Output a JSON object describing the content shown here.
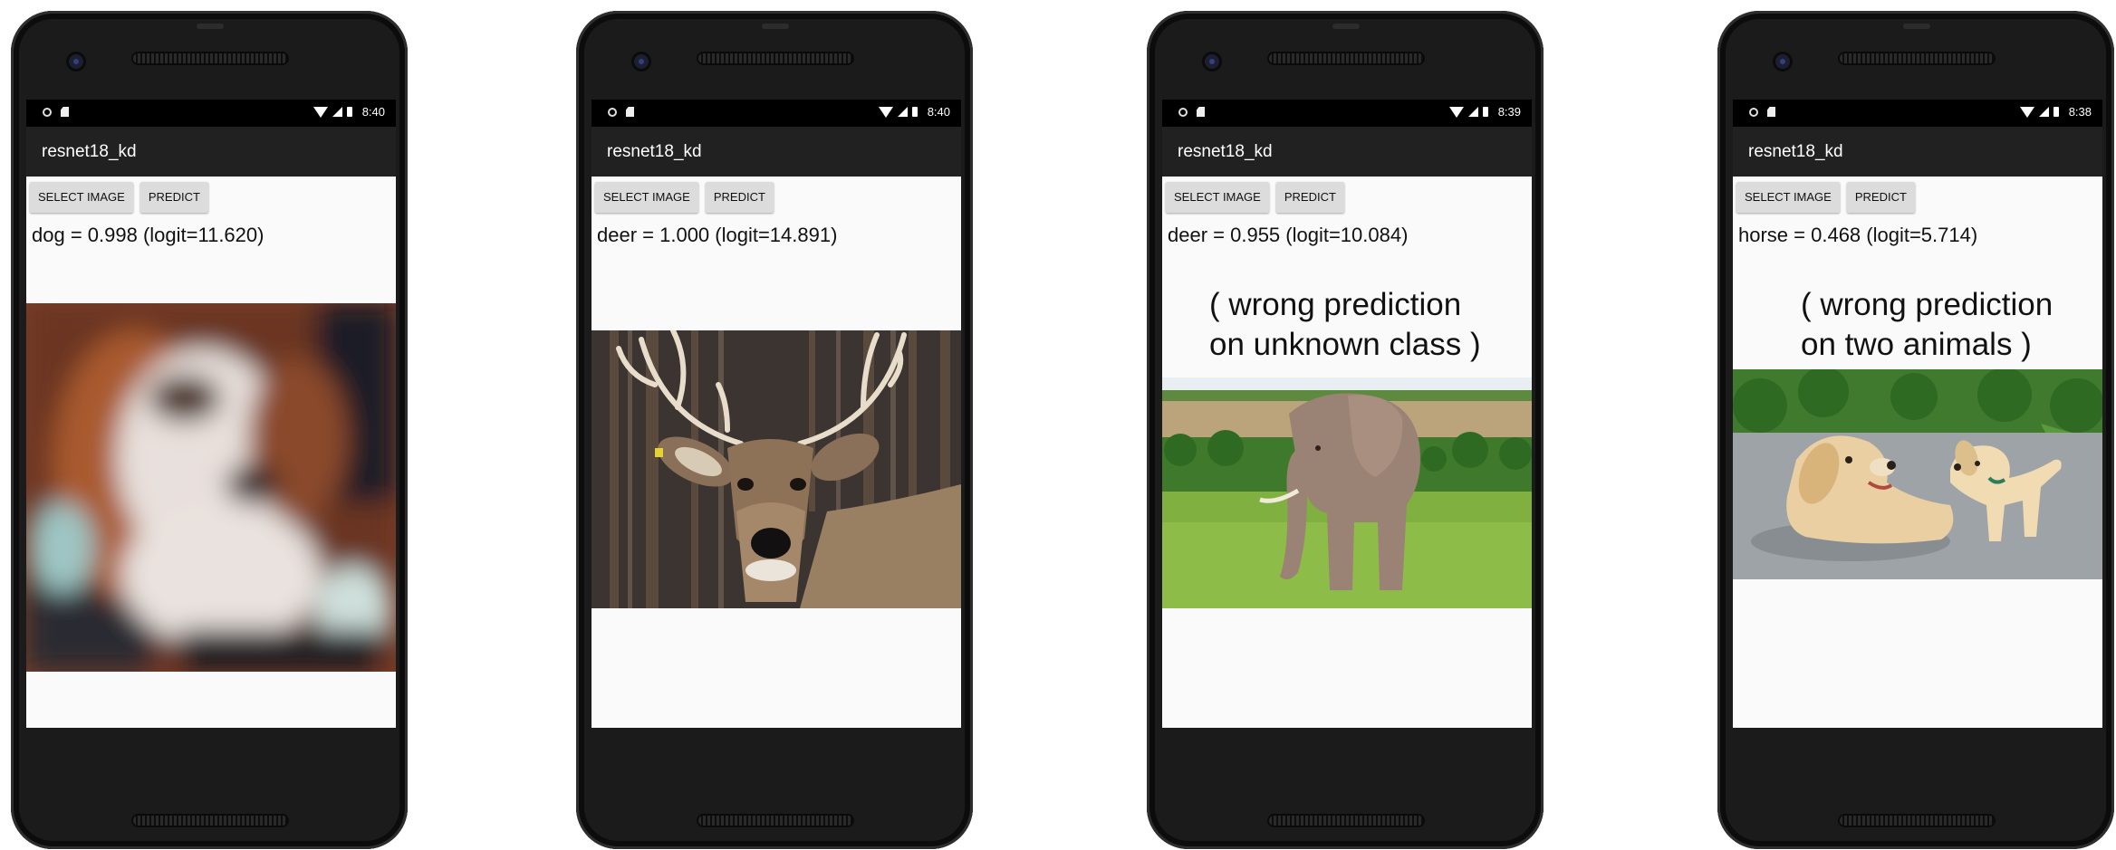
{
  "phones": [
    {
      "status": {
        "time": "8:40"
      },
      "app_title": "resnet18_kd",
      "buttons": {
        "select": "SELECT IMAGE",
        "predict": "PREDICT"
      },
      "result": "dog = 0.998 (logit=11.620)",
      "image": "dog-image",
      "annotation": ""
    },
    {
      "status": {
        "time": "8:40"
      },
      "app_title": "resnet18_kd",
      "buttons": {
        "select": "SELECT IMAGE",
        "predict": "PREDICT"
      },
      "result": "deer = 1.000 (logit=14.891)",
      "image": "deer-image",
      "annotation": ""
    },
    {
      "status": {
        "time": "8:39"
      },
      "app_title": "resnet18_kd",
      "buttons": {
        "select": "SELECT IMAGE",
        "predict": "PREDICT"
      },
      "result": "deer = 0.955 (logit=10.084)",
      "image": "elephant-image",
      "annotation": {
        "line1": "( wrong prediction",
        "line2": "on unknown class )"
      }
    },
    {
      "status": {
        "time": "8:38"
      },
      "app_title": "resnet18_kd",
      "buttons": {
        "select": "SELECT IMAGE",
        "predict": "PREDICT"
      },
      "result": "horse = 0.468 (logit=5.714)",
      "image": "two-puppies-image",
      "annotation": {
        "line1": "( wrong prediction",
        "line2": "on two animals )"
      }
    }
  ],
  "nav_icons": [
    "back-icon",
    "home-icon",
    "recents-icon"
  ]
}
